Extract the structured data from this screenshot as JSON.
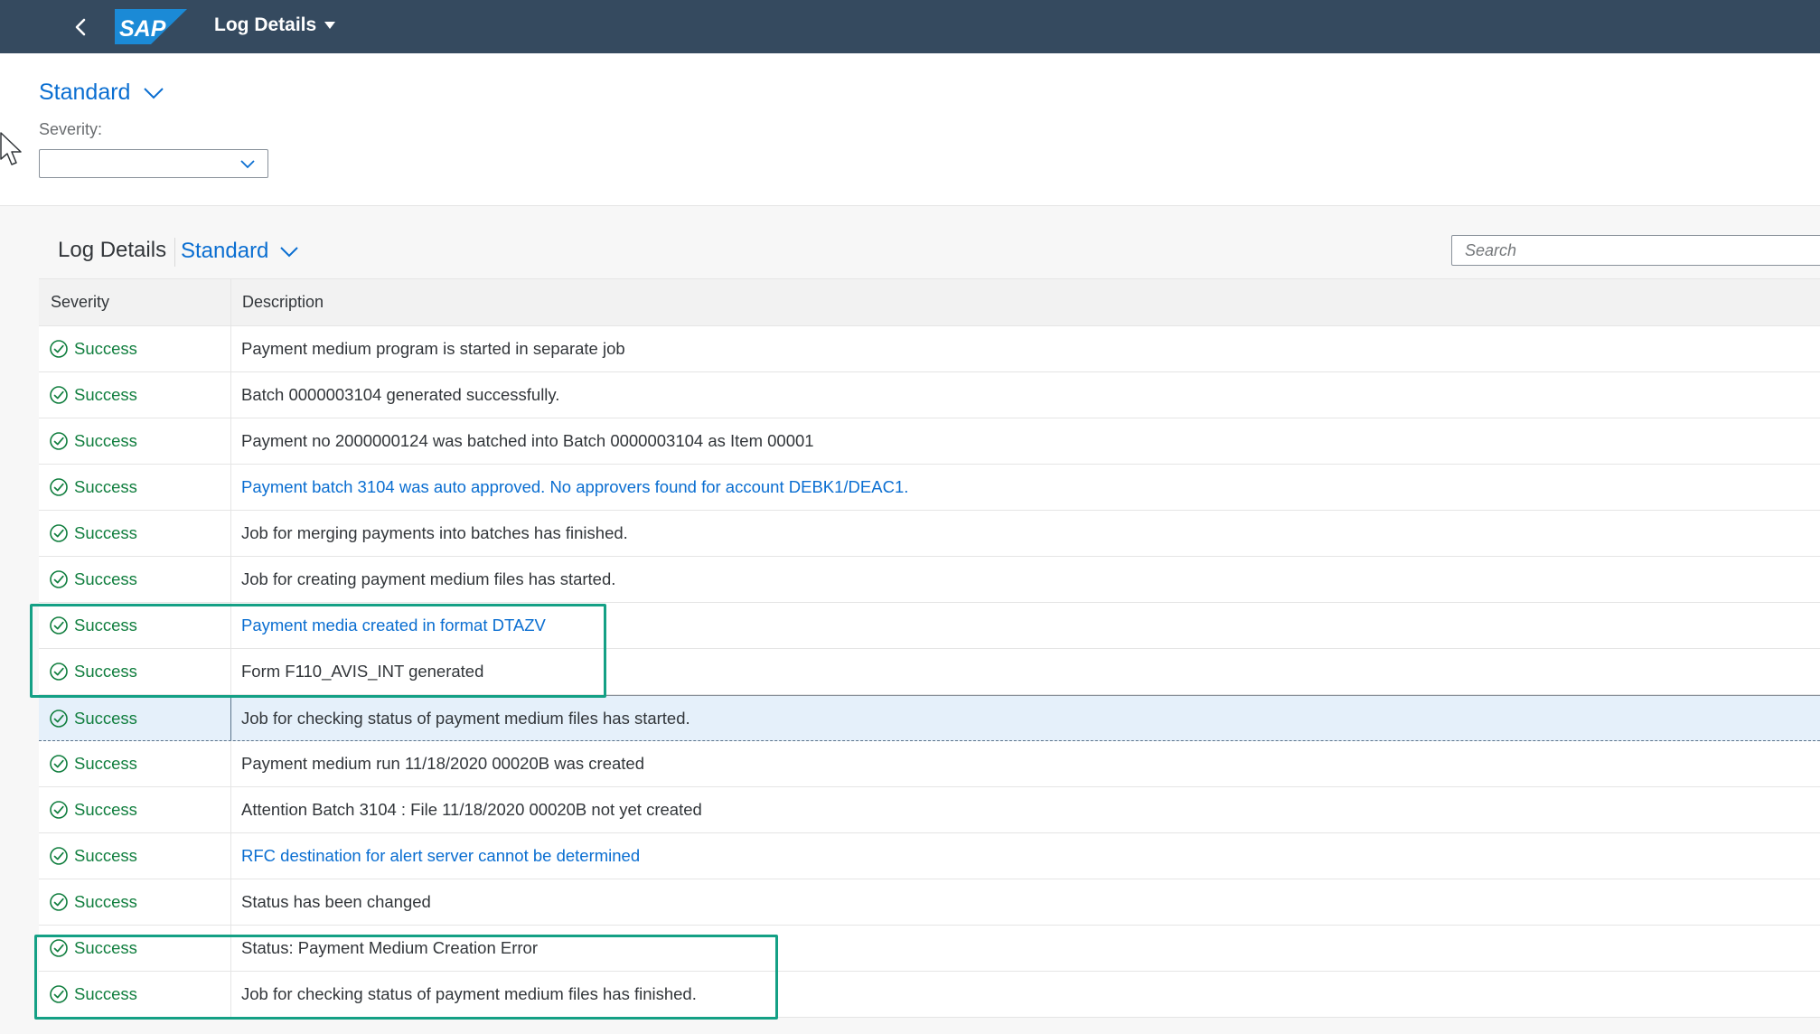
{
  "shell": {
    "logo_text": "SAP",
    "app_title": "Log Details"
  },
  "filter_bar": {
    "variant": "Standard",
    "severity_label": "Severity:",
    "severity_value": ""
  },
  "table_toolbar": {
    "title": "Log Details",
    "variant": "Standard",
    "search_placeholder": "Search"
  },
  "table": {
    "columns": [
      "Severity",
      "Description"
    ],
    "rows": [
      {
        "severity": "Success",
        "description": "Payment medium program is started in separate job",
        "link": false
      },
      {
        "severity": "Success",
        "description": "Batch 0000003104 generated successfully.",
        "link": false
      },
      {
        "severity": "Success",
        "description": "Payment no 2000000124 was batched into Batch 0000003104 as Item 00001",
        "link": false
      },
      {
        "severity": "Success",
        "description": "Payment batch 3104 was auto approved. No approvers found for account DEBK1/DEAC1.",
        "link": true
      },
      {
        "severity": "Success",
        "description": "Job for merging payments into batches has finished.",
        "link": false
      },
      {
        "severity": "Success",
        "description": "Job for creating payment medium files has started.",
        "link": false
      },
      {
        "severity": "Success",
        "description": "Payment media created in format DTAZV",
        "link": true
      },
      {
        "severity": "Success",
        "description": "Form F110_AVIS_INT generated",
        "link": false
      },
      {
        "severity": "Success",
        "description": "Job for checking status of payment medium files has started.",
        "link": false,
        "selected": true
      },
      {
        "severity": "Success",
        "description": "Payment medium run 11/18/2020 00020B was created",
        "link": false
      },
      {
        "severity": "Success",
        "description": "Attention Batch 3104 : File 11/18/2020 00020B not yet created",
        "link": false
      },
      {
        "severity": "Success",
        "description": "RFC destination for alert server cannot be determined",
        "link": true
      },
      {
        "severity": "Success",
        "description": "Status has been changed",
        "link": false
      },
      {
        "severity": "Success",
        "description": "Status: Payment Medium Creation Error",
        "link": false
      },
      {
        "severity": "Success",
        "description": "Job for checking status of payment medium files has finished.",
        "link": false
      }
    ]
  },
  "colors": {
    "shell_bg": "#354a5f",
    "link": "#0a6ed1",
    "success": "#107e3e",
    "highlight_box": "#14a085",
    "selected_row": "#e5f0fa"
  },
  "icons": {
    "back": "chevron-left-icon",
    "dropdown": "chevron-down-icon",
    "severity": "success-check-circle-icon"
  }
}
